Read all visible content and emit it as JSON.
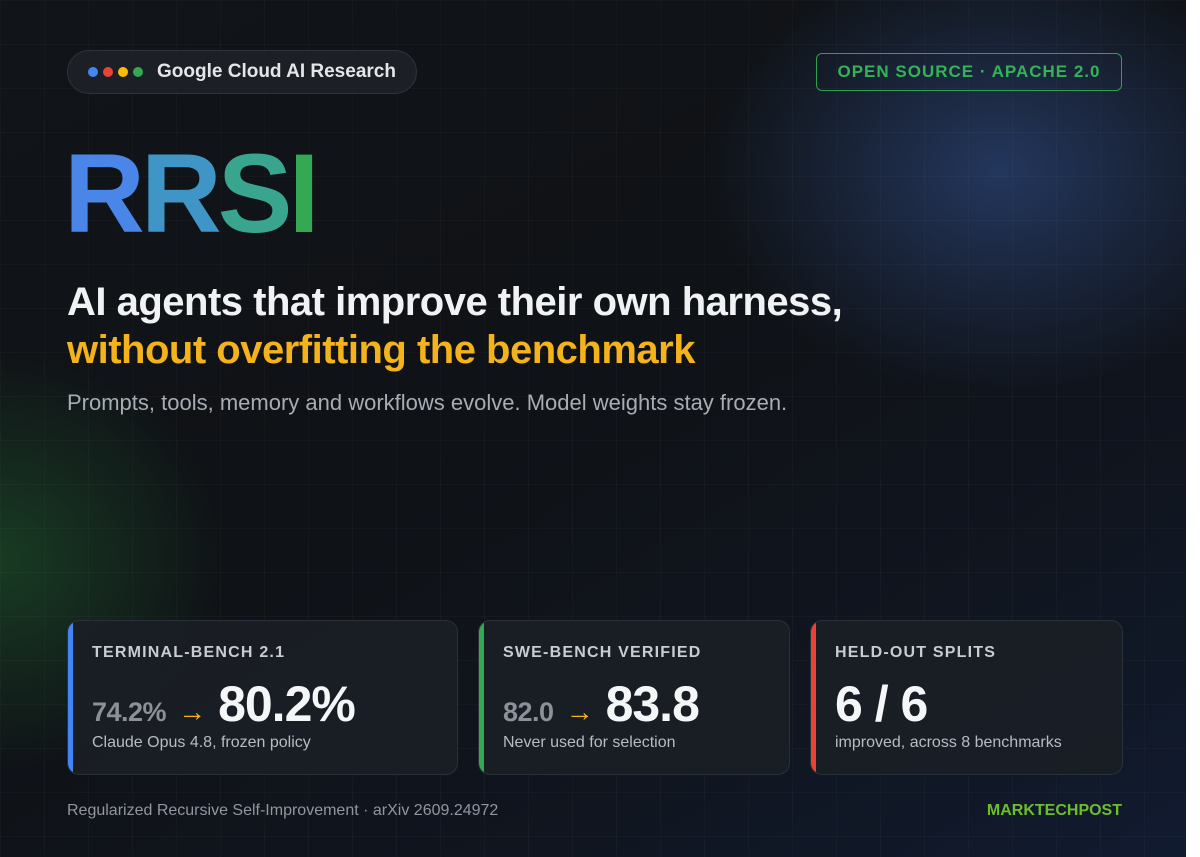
{
  "org": {
    "name": "Google Cloud AI Research",
    "dot_colors": [
      "#4285F4",
      "#EA4335",
      "#FBBC05",
      "#34A853"
    ]
  },
  "license_badge": "OPEN SOURCE · APACHE 2.0",
  "title": "RRSI",
  "title_letter_colors": [
    "#4a86e8",
    "#3f96c6",
    "#3aa58e",
    "#34a853"
  ],
  "headline": {
    "line1": "AI agents that improve their own harness,",
    "line2": "without overfitting the benchmark"
  },
  "subhead": "Prompts, tools, memory and workflows evolve. Model weights stay frozen.",
  "stats": [
    {
      "label": "TERMINAL-BENCH 2.1",
      "before": "74.2%",
      "arrow": "→",
      "after": "80.2%",
      "note": "Claude Opus 4.8, frozen policy",
      "accent": "#4285F4"
    },
    {
      "label": "SWE-BENCH VERIFIED",
      "before": "82.0",
      "arrow": "→",
      "after": "83.8",
      "note": "Never used for selection",
      "accent": "#34A853"
    },
    {
      "label": "HELD-OUT SPLITS",
      "before": "",
      "arrow": "",
      "after": "6 / 6",
      "note": "improved, across 8 benchmarks",
      "accent": "#EA4335"
    }
  ],
  "footer": {
    "left": "Regularized Recursive Self-Improvement · arXiv 2609.24972",
    "right": "MARKTECHPOST"
  },
  "colors": {
    "headline_accent": "#f4b31a",
    "license_green": "#34b356",
    "brand_green": "#6cbf2a"
  }
}
